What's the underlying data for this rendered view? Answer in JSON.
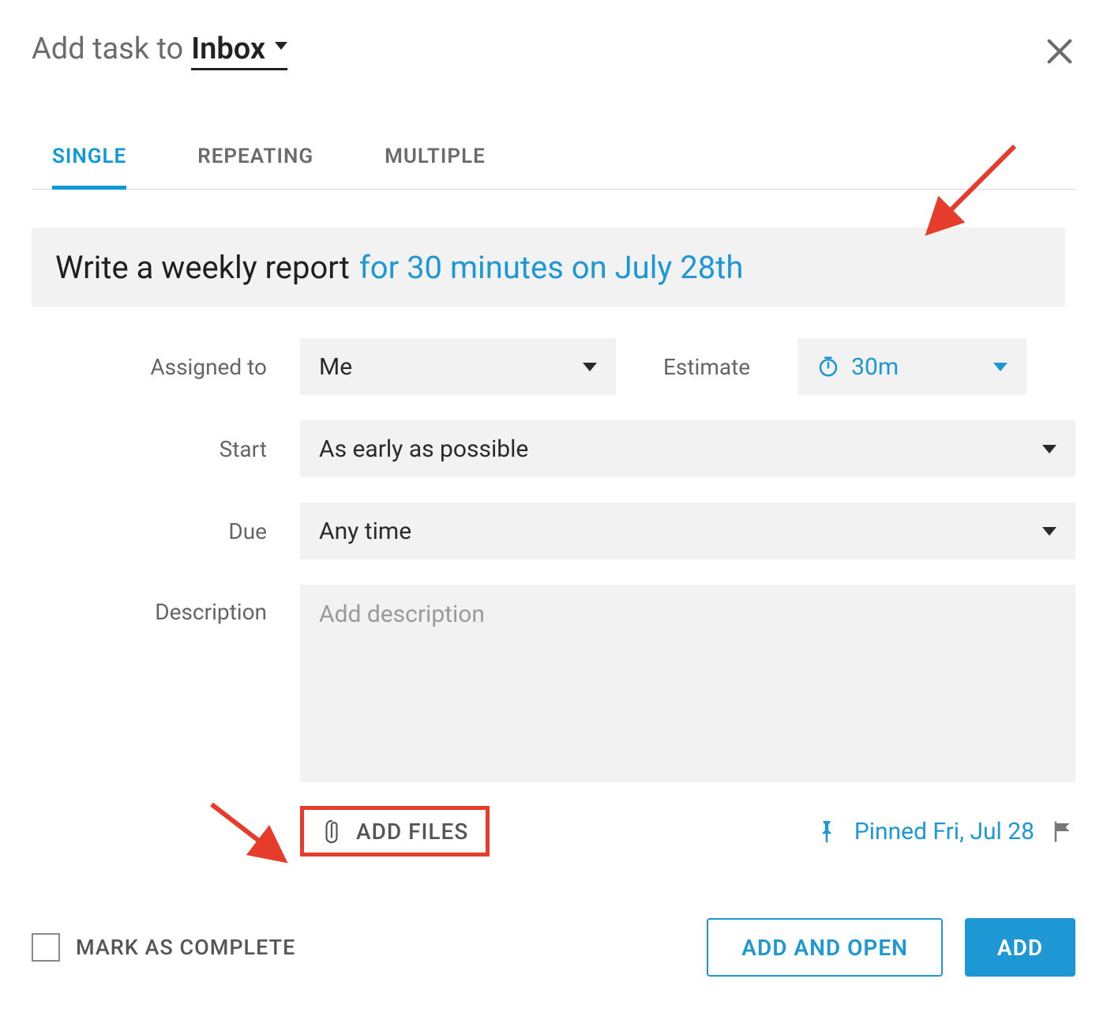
{
  "header": {
    "prefix": "Add task to",
    "target": "Inbox"
  },
  "tabs": {
    "single": "SINGLE",
    "repeating": "REPEATING",
    "multiple": "MULTIPLE"
  },
  "task_title": {
    "base": "Write a weekly report",
    "parsed": "for 30 minutes on July 28th"
  },
  "labels": {
    "assigned_to": "Assigned to",
    "estimate": "Estimate",
    "start": "Start",
    "due": "Due",
    "description": "Description"
  },
  "values": {
    "assigned_to": "Me",
    "estimate": "30m",
    "start": "As early as possible",
    "due": "Any time",
    "description_placeholder": "Add description"
  },
  "add_files_label": "ADD FILES",
  "pinned_text": "Pinned Fri, Jul 28",
  "footer": {
    "mark_complete": "MARK AS COMPLETE",
    "add_and_open": "ADD AND OPEN",
    "add": "ADD"
  },
  "colors": {
    "accent": "#1e98d4",
    "highlight_border": "#e53c2c"
  }
}
